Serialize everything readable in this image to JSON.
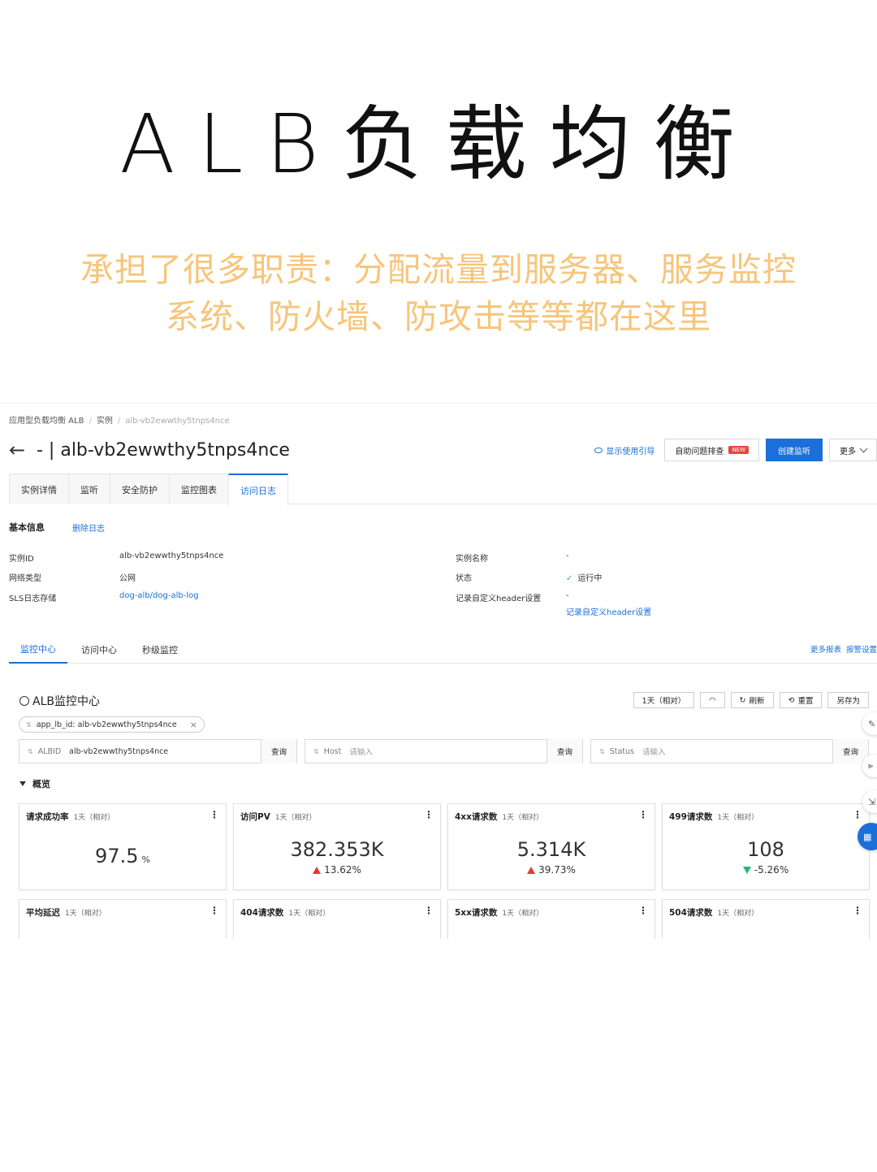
{
  "header": {
    "title": "ALB负载均衡",
    "subtitle_line1": "承担了很多职责：分配流量到服务器、服务监控",
    "subtitle_line2": "系统、防火墙、防攻击等等都在这里"
  },
  "breadcrumb": {
    "item1": "应用型负载均衡 ALB",
    "item2": "实例",
    "item3": "alb-vb2ewwthy5tnps4nce"
  },
  "page": {
    "title": "- | alb-vb2ewwthy5tnps4nce",
    "guide_label": "显示使用引导",
    "self_check_label": "自助问题排查",
    "new_badge": "NEW",
    "create_listener_label": "创建监听",
    "more_label": "更多"
  },
  "tabs": [
    "实例详情",
    "监听",
    "安全防护",
    "监控图表",
    "访问日志"
  ],
  "basic_info": {
    "title": "基本信息",
    "delete_log": "删除日志",
    "instance_id_k": "实例ID",
    "instance_id_v": "alb-vb2ewwthy5tnps4nce",
    "network_k": "网络类型",
    "network_v": "公网",
    "sls_k": "SLS日志存储",
    "sls_v": "dog-alb/dog-alb-log",
    "name_k": "实例名称",
    "name_v": "-",
    "status_k": "状态",
    "status_v": "运行中",
    "header_k": "记录自定义header设置",
    "header_v": "-",
    "header_link": "记录自定义header设置"
  },
  "subtabs": [
    "监控中心",
    "访问中心",
    "秒级监控"
  ],
  "sublinks": {
    "more_reports": "更多报表",
    "alert_settings": "报警设置"
  },
  "monitor": {
    "title": "ALB监控中心",
    "range_btn": "1天（相对）",
    "refresh": "刷新",
    "reset": "重置",
    "save_as": "另存为",
    "filter_tag": "app_lb_id: alb-vb2ewwthy5tnps4nce",
    "q1_label": "ALBID",
    "q1_value": "alb-vb2ewwthy5tnps4nce",
    "q2_label": "Host",
    "q2_placeholder": "请输入",
    "q3_label": "Status",
    "q3_placeholder": "请输入",
    "query": "查询",
    "overview": "概览"
  },
  "cards": [
    {
      "title": "请求成功率",
      "range": "1天（相对）",
      "value": "97.5",
      "unit": "%",
      "change": ""
    },
    {
      "title": "访问PV",
      "range": "1天（相对）",
      "value": "382.353K",
      "unit": "",
      "change": "13.62%"
    },
    {
      "title": "4xx请求数",
      "range": "1天（相对）",
      "value": "5.314K",
      "unit": "",
      "change": "39.73%"
    },
    {
      "title": "499请求数",
      "range": "1天（相对）",
      "value": "108",
      "unit": "",
      "change": "-5.26%"
    },
    {
      "title": "平均延迟",
      "range": "1天（相对）"
    },
    {
      "title": "404请求数",
      "range": "1天（相对）"
    },
    {
      "title": "5xx请求数",
      "range": "1天（相对）"
    },
    {
      "title": "504请求数",
      "range": "1天（相对）"
    }
  ],
  "colors": {
    "accent": "#1a6fd8",
    "subtitle": "#f6c57a",
    "up": "#e23a3a",
    "down": "#2bb673"
  }
}
